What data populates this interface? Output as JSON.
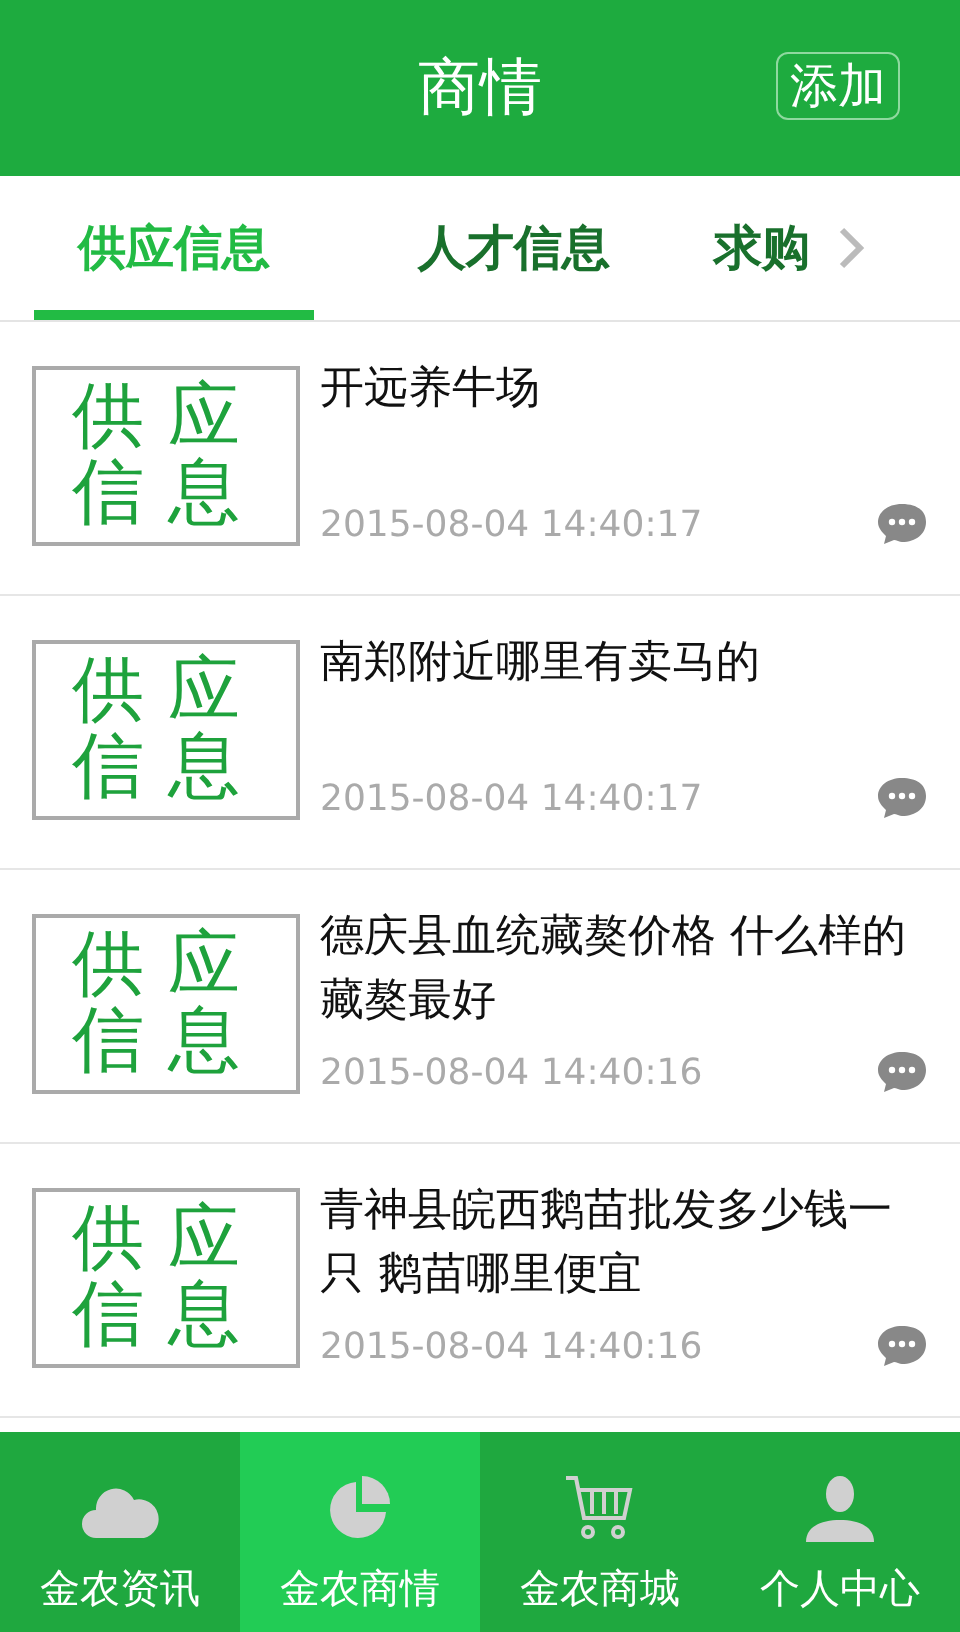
{
  "header": {
    "title": "商情",
    "add_button": "添加"
  },
  "tabs": [
    {
      "label": "供应信息",
      "selected": true
    },
    {
      "label": "人才信息",
      "selected": false
    },
    {
      "label": "求购",
      "selected": false
    }
  ],
  "items": [
    {
      "thumb_text": "供应信息",
      "title": "开远养牛场",
      "time": "2015-08-04 14:40:17"
    },
    {
      "thumb_text": "供应信息",
      "title": "南郑附近哪里有卖马的",
      "time": "2015-08-04 14:40:17"
    },
    {
      "thumb_text": "供应信息",
      "title": "德庆县血统藏獒价格  什么样的藏獒最好",
      "time": "2015-08-04 14:40:16"
    },
    {
      "thumb_text": "供应信息",
      "title": "青神县皖西鹅苗批发多少钱一只 鹅苗哪里便宜",
      "time": "2015-08-04 14:40:16"
    }
  ],
  "bottom_nav": [
    {
      "label": "金农资讯",
      "kind": "cloud",
      "selected": false
    },
    {
      "label": "金农商情",
      "kind": "pie",
      "selected": true
    },
    {
      "label": "金农商城",
      "kind": "cart",
      "selected": false
    },
    {
      "label": "个人中心",
      "kind": "person",
      "selected": false
    }
  ]
}
